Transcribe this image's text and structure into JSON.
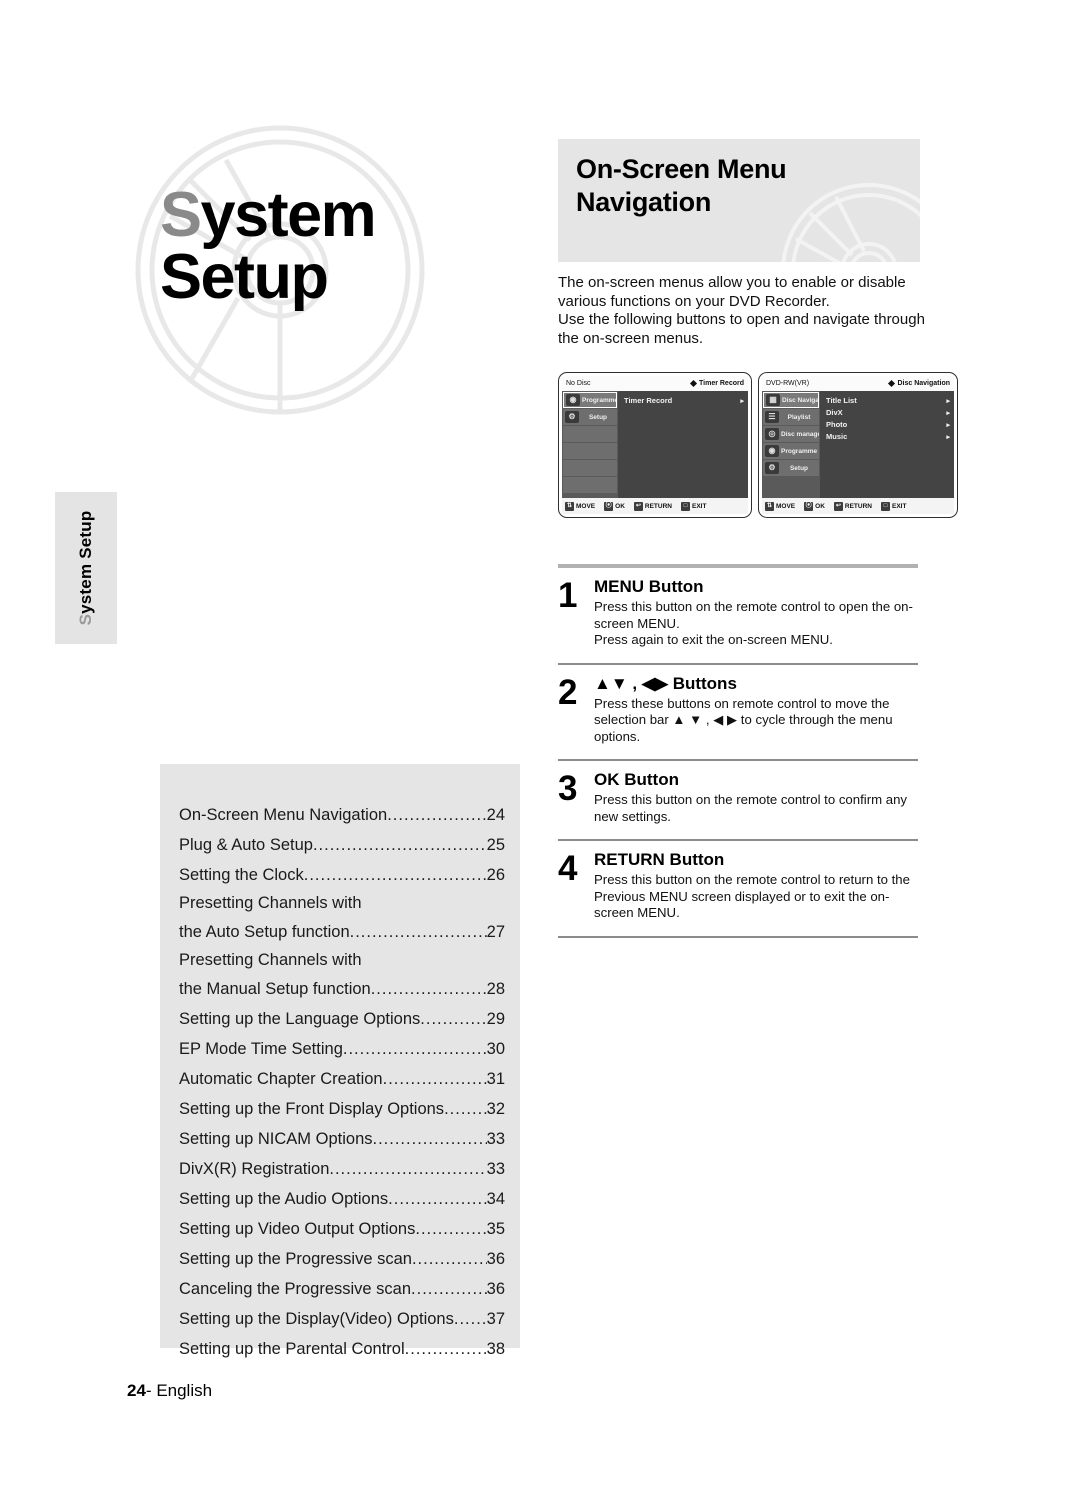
{
  "chapter": {
    "title_cap": "S",
    "title_rest": "ystem",
    "title_line2": "Setup",
    "side_tab_cap": "S",
    "side_tab_rest": "ystem Setup"
  },
  "section": {
    "heading_line1": "On-Screen Menu",
    "heading_line2": "Navigation",
    "intro": "The on-screen menus allow you to enable or disable various functions on your DVD Recorder.\nUse the following buttons to open and navigate through the on-screen menus."
  },
  "osd_screens": [
    {
      "disc_label": "No Disc",
      "mode_label": "Timer Record",
      "sidebar": [
        {
          "label": "Programme",
          "icon": "programme-icon",
          "selected": true
        },
        {
          "label": "Setup",
          "icon": "gear-icon",
          "selected": false
        },
        {
          "label": "",
          "icon": "",
          "selected": false
        },
        {
          "label": "",
          "icon": "",
          "selected": false
        },
        {
          "label": "",
          "icon": "",
          "selected": false
        },
        {
          "label": "",
          "icon": "",
          "selected": false
        }
      ],
      "menu_items": [
        "Timer Record"
      ],
      "bottom_bar": [
        {
          "icon": "updown-icon",
          "label": "MOVE"
        },
        {
          "icon": "ok-icon",
          "label": "OK"
        },
        {
          "icon": "return-icon",
          "label": "RETURN"
        },
        {
          "icon": "exit-icon",
          "label": "EXIT"
        }
      ]
    },
    {
      "disc_label": "DVD-RW(VR)",
      "mode_label": "Disc Navigation",
      "sidebar": [
        {
          "label": "Disc Navigation",
          "icon": "disc-navigation-icon",
          "selected": true
        },
        {
          "label": "Playlist",
          "icon": "playlist-icon",
          "selected": false
        },
        {
          "label": "Disc manager",
          "icon": "disc-manager-icon",
          "selected": false
        },
        {
          "label": "Programme",
          "icon": "programme-icon",
          "selected": false
        },
        {
          "label": "Setup",
          "icon": "gear-icon",
          "selected": false
        }
      ],
      "menu_items": [
        "Title List",
        "DivX",
        "Photo",
        "Music"
      ],
      "bottom_bar": [
        {
          "icon": "updown-icon",
          "label": "MOVE"
        },
        {
          "icon": "ok-icon",
          "label": "OK"
        },
        {
          "icon": "return-icon",
          "label": "RETURN"
        },
        {
          "icon": "exit-icon",
          "label": "EXIT"
        }
      ]
    }
  ],
  "steps": [
    {
      "num": "1",
      "title": "MENU Button",
      "desc": "Press this button on the remote control to open the on-screen MENU.\nPress again to exit the on-screen MENU."
    },
    {
      "num": "2",
      "title": "▲▼ , ◀▶ Buttons",
      "desc": "Press these buttons on remote control to move the selection bar ▲ ▼ , ◀ ▶ to cycle through the menu options."
    },
    {
      "num": "3",
      "title": "OK Button",
      "desc": "Press this button on the remote control to confirm any new settings."
    },
    {
      "num": "4",
      "title": "RETURN Button",
      "desc": "Press this button on the remote control to return to the Previous MENU screen displayed or to exit the on-screen MENU."
    }
  ],
  "toc": [
    {
      "label": "On-Screen Menu Navigation",
      "page": "24",
      "wrap": null
    },
    {
      "label": "Plug & Auto Setup",
      "page": "25",
      "wrap": null
    },
    {
      "label": "Setting the Clock",
      "page": "26",
      "wrap": null
    },
    {
      "label": "the Auto Setup function",
      "page": "27",
      "wrap": "Presetting Channels with"
    },
    {
      "label": "the Manual Setup function ",
      "page": "28",
      "wrap": "Presetting Channels with"
    },
    {
      "label": "Setting up the Language Options ",
      "page": "29",
      "wrap": null
    },
    {
      "label": "EP Mode Time Setting ",
      "page": "30",
      "wrap": null
    },
    {
      "label": "Automatic Chapter Creation",
      "page": "31",
      "wrap": null
    },
    {
      "label": "Setting up the Front Display Options ",
      "page": "32",
      "wrap": null
    },
    {
      "label": "Setting up NICAM Options",
      "page": "33",
      "wrap": null
    },
    {
      "label": "DivX(R) Registration",
      "page": "33",
      "wrap": null
    },
    {
      "label": "Setting up the Audio Options ",
      "page": "34",
      "wrap": null
    },
    {
      "label": "Setting up Video Output Options",
      "page": "35",
      "wrap": null
    },
    {
      "label": "Setting up the Progressive scan ",
      "page": "36",
      "wrap": null
    },
    {
      "label": "Canceling the Progressive scan",
      "page": "36",
      "wrap": null
    },
    {
      "label": "Setting up the Display(Video) Options ",
      "page": "37",
      "wrap": null
    },
    {
      "label": "Setting up the Parental Control",
      "page": "38",
      "wrap": null
    }
  ],
  "footer": {
    "page_number": "24",
    "separator": "- ",
    "language": "English"
  },
  "colors": {
    "panel_gray": "#e5e5e5",
    "rule_gray": "#b2b2b2",
    "osd_dark": "#4c4c4c",
    "cap_gray": "#8a8a8a"
  }
}
